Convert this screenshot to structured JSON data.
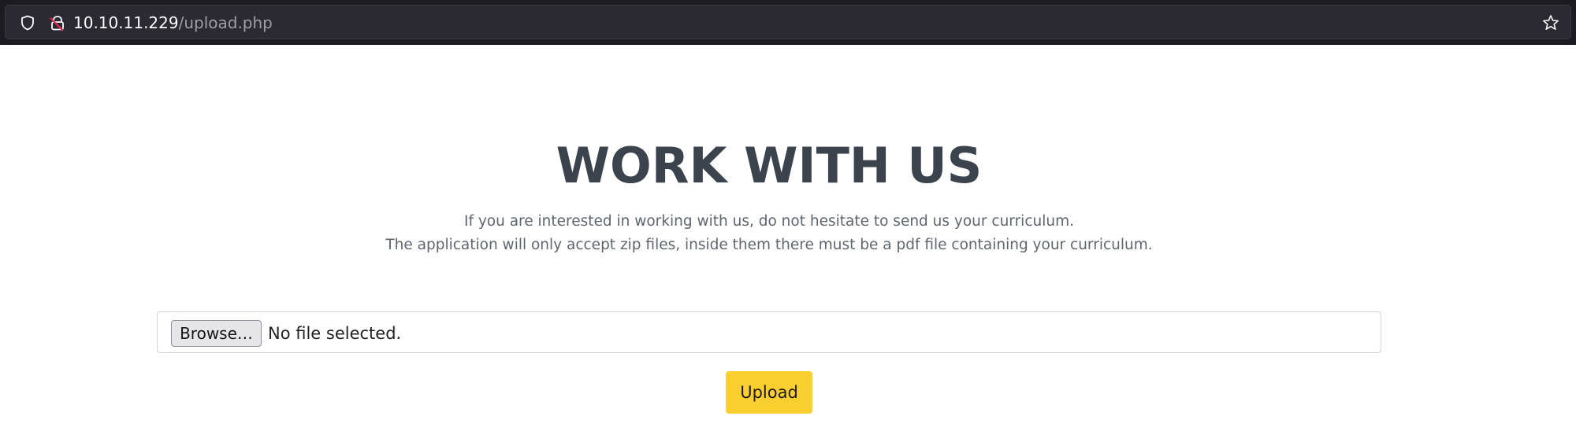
{
  "browser": {
    "url_host": "10.10.11.229",
    "url_path": "/upload.php",
    "icons": {
      "shield": "shield-icon",
      "lock": "insecure-lock-icon",
      "bookmark": "star-icon"
    }
  },
  "page": {
    "title": "WORK WITH US",
    "description_line1": "If you are interested in working with us, do not hesitate to send us your curriculum.",
    "description_line2": "The application will only accept zip files, inside them there must be a pdf file containing your curriculum."
  },
  "upload_form": {
    "browse_label": "Browse…",
    "file_status": "No file selected.",
    "upload_label": "Upload"
  },
  "colors": {
    "browser_bg": "#1c1b22",
    "title": "#3b434d",
    "upload_button": "#fbcf2f"
  }
}
